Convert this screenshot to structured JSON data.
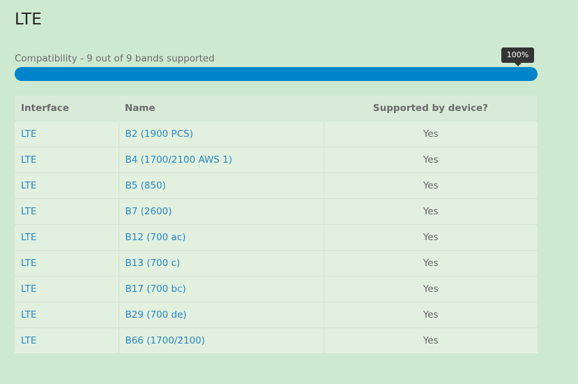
{
  "section": {
    "title": "LTE"
  },
  "compatibility": {
    "label": "Compatibility - 9 out of 9 bands supported",
    "percent": 100,
    "tooltip": "100%",
    "bar_color": "#0085cb"
  },
  "table": {
    "headers": {
      "interface": "Interface",
      "name": "Name",
      "supported": "Supported by device?"
    },
    "rows": [
      {
        "interface": "LTE",
        "name": "B2 (1900 PCS)",
        "supported": "Yes"
      },
      {
        "interface": "LTE",
        "name": "B4 (1700/2100 AWS 1)",
        "supported": "Yes"
      },
      {
        "interface": "LTE",
        "name": "B5 (850)",
        "supported": "Yes"
      },
      {
        "interface": "LTE",
        "name": "B7 (2600)",
        "supported": "Yes"
      },
      {
        "interface": "LTE",
        "name": "B12 (700 ac)",
        "supported": "Yes"
      },
      {
        "interface": "LTE",
        "name": "B13 (700 c)",
        "supported": "Yes"
      },
      {
        "interface": "LTE",
        "name": "B17 (700 bc)",
        "supported": "Yes"
      },
      {
        "interface": "LTE",
        "name": "B29 (700 de)",
        "supported": "Yes"
      },
      {
        "interface": "LTE",
        "name": "B66 (1700/2100)",
        "supported": "Yes"
      }
    ]
  },
  "colors": {
    "background": "#cde9cf",
    "link": "#2a87c4"
  }
}
